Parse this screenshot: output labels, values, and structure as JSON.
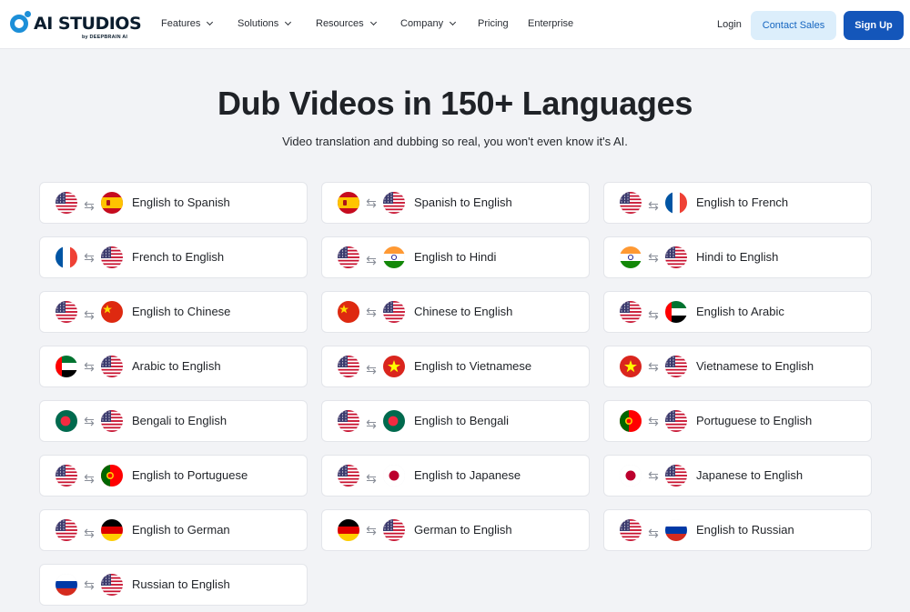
{
  "brand": {
    "name": "AI STUDIOS",
    "byline": "by DEEPBRAIN AI",
    "accent": "#1c8fd8"
  },
  "nav": {
    "items": [
      {
        "label": "Features",
        "has_dropdown": true
      },
      {
        "label": "Solutions",
        "has_dropdown": true
      },
      {
        "label": "Resources",
        "has_dropdown": true
      },
      {
        "label": "Company",
        "has_dropdown": true
      },
      {
        "label": "Pricing",
        "has_dropdown": false
      },
      {
        "label": "Enterprise",
        "has_dropdown": false
      }
    ],
    "login": "Login",
    "contact_sales": "Contact Sales",
    "sign_up": "Sign Up"
  },
  "hero": {
    "title": "Dub Videos in 150+ Languages",
    "subtitle": "Video translation and dubbing so real, you won't even know it's AI."
  },
  "swap_icon": "swap-arrows-icon",
  "cards": [
    {
      "label": "English to Spanish",
      "from": "us",
      "to": "es"
    },
    {
      "label": "Spanish to English",
      "from": "es",
      "to": "us"
    },
    {
      "label": "English to French",
      "from": "us",
      "to": "fr"
    },
    {
      "label": "French to English",
      "from": "fr",
      "to": "us"
    },
    {
      "label": "English to Hindi",
      "from": "us",
      "to": "in"
    },
    {
      "label": "Hindi to English",
      "from": "in",
      "to": "us"
    },
    {
      "label": "English to Chinese",
      "from": "us",
      "to": "cn"
    },
    {
      "label": "Chinese to English",
      "from": "cn",
      "to": "us"
    },
    {
      "label": "English to Arabic",
      "from": "us",
      "to": "ae"
    },
    {
      "label": "Arabic to English",
      "from": "ae",
      "to": "us"
    },
    {
      "label": "English to Vietnamese",
      "from": "us",
      "to": "vn"
    },
    {
      "label": "Vietnamese to English",
      "from": "vn",
      "to": "us"
    },
    {
      "label": "Bengali to English",
      "from": "bd",
      "to": "us"
    },
    {
      "label": "English to Bengali",
      "from": "us",
      "to": "bd"
    },
    {
      "label": "Portuguese to English",
      "from": "pt",
      "to": "us"
    },
    {
      "label": "English to Portuguese",
      "from": "us",
      "to": "pt"
    },
    {
      "label": "English to Japanese",
      "from": "us",
      "to": "jp"
    },
    {
      "label": "Japanese to English",
      "from": "jp",
      "to": "us"
    },
    {
      "label": "English to German",
      "from": "us",
      "to": "de"
    },
    {
      "label": "German to English",
      "from": "de",
      "to": "us"
    },
    {
      "label": "English to Russian",
      "from": "us",
      "to": "ru"
    },
    {
      "label": "Russian to English",
      "from": "ru",
      "to": "us"
    }
  ]
}
